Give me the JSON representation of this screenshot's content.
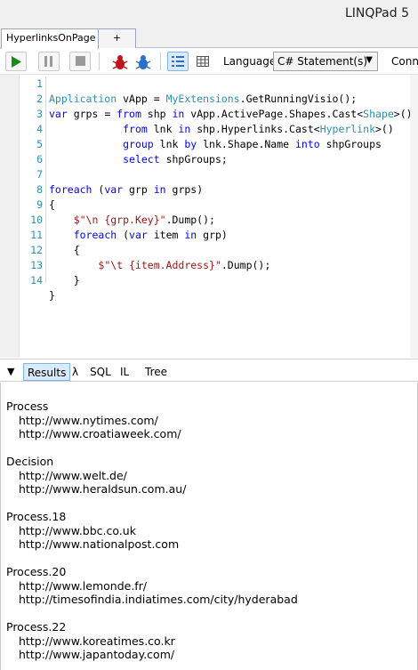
{
  "app": {
    "title": "LINQPad 5"
  },
  "tabs": [
    {
      "label": "HyperlinksOnPage"
    },
    {
      "label": "+"
    }
  ],
  "toolbar": {
    "run_icon": "play-icon",
    "pause_icon": "pause-icon",
    "stop_icon": "stop-icon",
    "language_label": "Language",
    "language_value": "C# Statement(s)",
    "connection_label": "Conn"
  },
  "editor": {
    "line_numbers": [
      "1",
      "2",
      "3",
      "4",
      "5",
      "6",
      "7",
      "8",
      "9",
      "10",
      "11",
      "12",
      "13",
      "14"
    ]
  },
  "results_bar": {
    "results": "Results",
    "lambda": "λ",
    "sql": "SQL",
    "il": "IL",
    "tree": "Tree"
  },
  "output": {
    "groups": [
      {
        "key": "Process",
        "urls": [
          "http://www.nytimes.com/",
          "http://www.croatiaweek.com/"
        ]
      },
      {
        "key": "Decision",
        "urls": [
          "http://www.welt.de/",
          "http://www.heraldsun.com.au/"
        ]
      },
      {
        "key": "Process.18",
        "urls": [
          "http://www.bbc.co.uk",
          "http://www.nationalpost.com"
        ]
      },
      {
        "key": "Process.20",
        "urls": [
          "http://www.lemonde.fr/",
          "http://timesofindia.indiatimes.com/city/hyderabad"
        ]
      },
      {
        "key": "Process.22",
        "urls": [
          "http://www.koreatimes.co.kr",
          "http://www.japantoday.com/"
        ]
      }
    ]
  },
  "colors": {
    "keyword": "#0000ff",
    "type": "#2b91af",
    "string": "#a31515",
    "selected_tab": "#dbeaf8"
  }
}
